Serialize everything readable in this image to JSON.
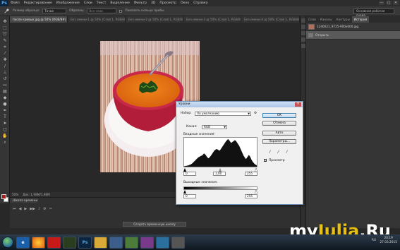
{
  "app": {
    "logo": "Ps",
    "menu": [
      "Файл",
      "Редактирование",
      "Изображение",
      "Слои",
      "Текст",
      "Выделение",
      "Фильтр",
      "3D",
      "Просмотр",
      "Окно",
      "Справка"
    ],
    "window_controls": [
      "—",
      "□",
      "✕"
    ]
  },
  "options_bar": {
    "sample_size_label": "Размер образца:",
    "sample_size_value": "Точка",
    "sample_label": "Образец:",
    "sample_value": "Все слои",
    "show_ring_label": "Показать кольцо пробы",
    "workspace": "Основная рабочая среда"
  },
  "doc_tabs": [
    "после кривых.jpg @ 50% (RGB/8#) *",
    "Без имени-1 @ 50% (Слой 1, RGB/8) *",
    "Без имени-2 @ 50% (Слой 1, RGB/8) *",
    "Без имени-3 @ 50% (Слой 1, RGB/8) *",
    "Без имени-4 @ 50% (Слой 1, RGB/8) *"
  ],
  "status": {
    "zoom": "50%",
    "doc": "Док: 1,98М/1,98М"
  },
  "timeline": {
    "title": "Шкала времени",
    "create_button": "Создать временную шкалу"
  },
  "panel": {
    "tabs": [
      "Слои",
      "Каналы",
      "Контуры",
      "История"
    ],
    "active_tab": "История",
    "history": [
      {
        "label": "1240021_9725-900x600.jpg",
        "kind": "snapshot"
      },
      {
        "label": "Открыть",
        "kind": "step"
      }
    ]
  },
  "levels": {
    "title": "Уровни",
    "preset_label": "Набор:",
    "preset_value": "По умолчанию",
    "channel_label": "Канал:",
    "channel_value": "RGB",
    "input_label": "Входные значения:",
    "input_black": "0",
    "input_gamma": "1,00",
    "input_white": "255",
    "output_label": "Выходные значения:",
    "output_black": "0",
    "output_white": "255",
    "buttons": {
      "ok": "OK",
      "cancel": "Отмена",
      "auto": "Авто",
      "options": "Параметры..."
    },
    "preview_label": "Просмотр",
    "preview_checked": "✓",
    "close": "✕",
    "histogram": [
      2,
      2,
      3,
      3,
      4,
      4,
      5,
      6,
      7,
      8,
      10,
      12,
      14,
      17,
      20,
      22,
      25,
      28,
      30,
      33,
      35,
      36,
      38,
      39,
      40,
      42,
      45,
      48,
      46,
      44,
      40,
      36,
      33,
      30,
      32,
      35,
      38,
      42,
      46,
      50,
      54,
      58,
      60,
      62,
      64,
      63,
      62,
      60,
      58,
      60,
      64,
      68,
      72,
      76,
      80,
      84,
      88,
      92,
      95,
      98,
      100,
      97,
      94,
      90,
      86,
      88,
      90,
      92,
      94,
      96,
      95,
      92,
      88,
      84,
      80,
      76,
      70,
      64,
      58,
      52,
      46,
      40,
      36,
      32,
      28,
      30,
      34,
      38,
      42,
      40,
      36,
      30,
      24,
      20,
      16,
      13,
      10,
      8,
      6,
      5
    ]
  },
  "taskbar": {
    "apps": [
      "e",
      "",
      "",
      "",
      "Ps",
      "",
      "",
      "",
      "",
      "",
      ""
    ],
    "tray": "RU",
    "time": "20:19",
    "date": "27.03.2015"
  },
  "watermark": {
    "part1": "my",
    "part2": "Julia",
    "part3": ".Ru"
  },
  "colors": {
    "accent": "#3c7fb1",
    "ps_logo": "#4fa7e6",
    "watermark_yellow": "#e8c010"
  }
}
